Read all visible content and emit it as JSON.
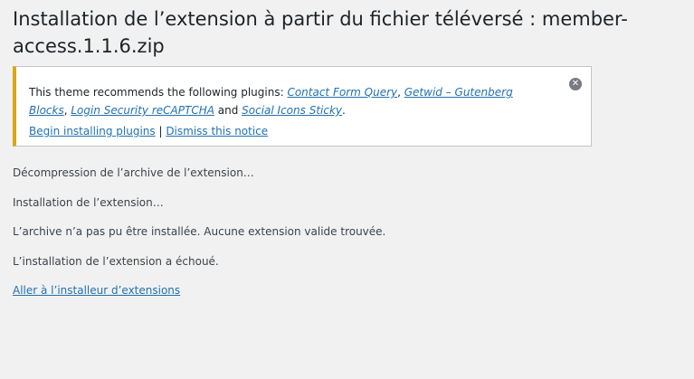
{
  "page": {
    "title": "Installation de l’extension à partir du fichier téléversé : member-access.1.1.6.zip"
  },
  "notice": {
    "intro": "This theme recommends the following plugins: ",
    "plugins": [
      "Contact Form Query",
      "Getwid – Gutenberg Blocks",
      "Login Security reCAPTCHA",
      "Social Icons Sticky"
    ],
    "sep1": ", ",
    "sep2": ", ",
    "and": " and ",
    "end": ".",
    "begin_installing": "Begin installing plugins",
    "pipe": " | ",
    "dismiss_notice": "Dismiss this notice",
    "close_glyph": "✕",
    "close_icon": "close-icon",
    "accent_color": "#dba617"
  },
  "messages": [
    "Décompression de l’archive de l’extension…",
    "Installation de l’extension…",
    "L’archive n’a pas pu être installée. Aucune extension valide trouvée.",
    "L’installation de l’extension a échoué."
  ],
  "back_link": "Aller à l’installeur d’extensions"
}
